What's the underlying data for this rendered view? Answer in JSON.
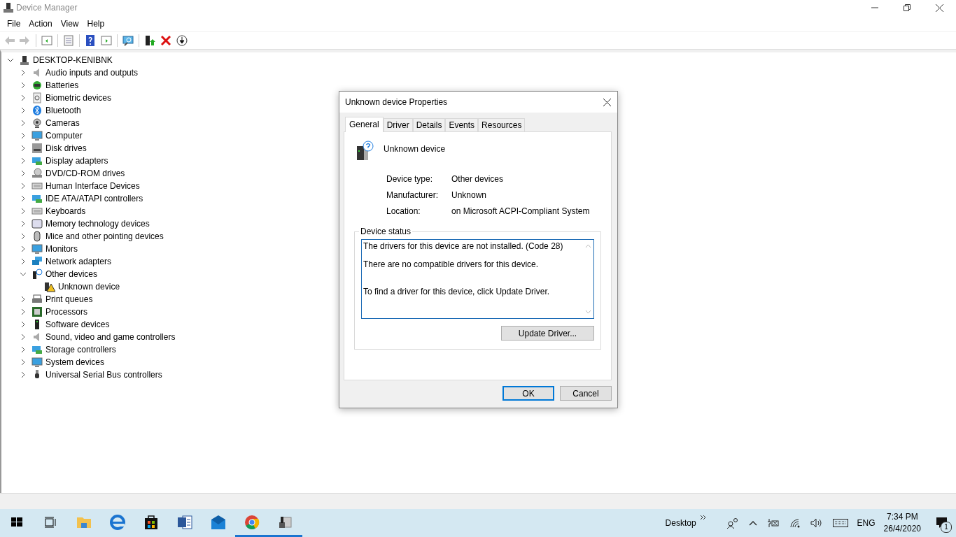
{
  "window": {
    "title": "Device Manager"
  },
  "menu": [
    "File",
    "Action",
    "View",
    "Help"
  ],
  "toolbar": [
    {
      "kind": "back",
      "disabled": true
    },
    {
      "kind": "forward",
      "disabled": true
    },
    {
      "kind": "sep"
    },
    {
      "kind": "tree-pane",
      "disabled": false
    },
    {
      "kind": "sep"
    },
    {
      "kind": "properties",
      "disabled": false
    },
    {
      "kind": "sep"
    },
    {
      "kind": "help",
      "disabled": false
    },
    {
      "kind": "action-pane",
      "disabled": false
    },
    {
      "kind": "sep"
    },
    {
      "kind": "scan",
      "disabled": false
    },
    {
      "kind": "sep"
    },
    {
      "kind": "update",
      "disabled": false
    },
    {
      "kind": "uninstall",
      "disabled": false
    },
    {
      "kind": "download",
      "disabled": false
    }
  ],
  "tree": {
    "label": "DESKTOP-KENIBNK",
    "kind": "pc",
    "expanded": true,
    "children": [
      {
        "label": "Audio inputs and outputs",
        "kind": "speaker",
        "expanded": false
      },
      {
        "label": "Batteries",
        "kind": "battery",
        "expanded": false
      },
      {
        "label": "Biometric devices",
        "kind": "fingerprint",
        "expanded": false
      },
      {
        "label": "Bluetooth",
        "kind": "bluetooth",
        "expanded": false
      },
      {
        "label": "Cameras",
        "kind": "camera",
        "expanded": false
      },
      {
        "label": "Computer",
        "kind": "monitor",
        "expanded": false
      },
      {
        "label": "Disk drives",
        "kind": "disk",
        "expanded": false
      },
      {
        "label": "Display adapters",
        "kind": "card",
        "expanded": false
      },
      {
        "label": "DVD/CD-ROM drives",
        "kind": "disc",
        "expanded": false
      },
      {
        "label": "Human Interface Devices",
        "kind": "keyboard",
        "expanded": false
      },
      {
        "label": "IDE ATA/ATAPI controllers",
        "kind": "card",
        "expanded": false
      },
      {
        "label": "Keyboards",
        "kind": "keyboard",
        "expanded": false
      },
      {
        "label": "Memory technology devices",
        "kind": "memory",
        "expanded": false
      },
      {
        "label": "Mice and other pointing devices",
        "kind": "mouse",
        "expanded": false
      },
      {
        "label": "Monitors",
        "kind": "monitor",
        "expanded": false
      },
      {
        "label": "Network adapters",
        "kind": "network",
        "expanded": false
      },
      {
        "label": "Other devices",
        "kind": "unknown",
        "expanded": true,
        "children": [
          {
            "label": "Unknown device",
            "kind": "warning"
          }
        ]
      },
      {
        "label": "Print queues",
        "kind": "printer",
        "expanded": false
      },
      {
        "label": "Processors",
        "kind": "chip",
        "expanded": false
      },
      {
        "label": "Software devices",
        "kind": "tower",
        "expanded": false
      },
      {
        "label": "Sound, video and game controllers",
        "kind": "speaker",
        "expanded": false
      },
      {
        "label": "Storage controllers",
        "kind": "card",
        "expanded": false
      },
      {
        "label": "System devices",
        "kind": "monitor",
        "expanded": false
      },
      {
        "label": "Universal Serial Bus controllers",
        "kind": "usb",
        "expanded": false
      }
    ]
  },
  "dialog": {
    "title": "Unknown device Properties",
    "tabs": [
      {
        "label": "General",
        "selected": true
      },
      {
        "label": "Driver",
        "selected": false
      },
      {
        "label": "Details",
        "selected": false
      },
      {
        "label": "Events",
        "selected": false
      },
      {
        "label": "Resources",
        "selected": false
      }
    ],
    "device_name": "Unknown device",
    "properties": [
      {
        "label": "Device type:",
        "value": "Other devices"
      },
      {
        "label": "Manufacturer:",
        "value": "Unknown"
      },
      {
        "label": "Location:",
        "value": "on Microsoft ACPI-Compliant System"
      }
    ],
    "status_title": "Device status",
    "status_lines": [
      "The drivers for this device are not installed. (Code 28)",
      "There are no compatible drivers for this device.",
      "To find a driver for this device, click Update Driver."
    ],
    "update_button": "Update Driver...",
    "ok": "OK",
    "cancel": "Cancel"
  },
  "taskbar": {
    "apps": [
      {
        "kind": "start",
        "running": false
      },
      {
        "kind": "task-view",
        "running": false
      },
      {
        "kind": "folder",
        "running": false
      },
      {
        "kind": "browser-e",
        "running": false
      },
      {
        "kind": "store",
        "running": false
      },
      {
        "kind": "document",
        "running": false
      },
      {
        "kind": "mail",
        "running": false
      },
      {
        "kind": "chrome",
        "running": true
      },
      {
        "kind": "device",
        "running": true
      }
    ],
    "desktop_label": "Desktop",
    "language": "ENG",
    "time": "7:34 PM",
    "date": "26/4/2020",
    "notification_count": "1"
  }
}
